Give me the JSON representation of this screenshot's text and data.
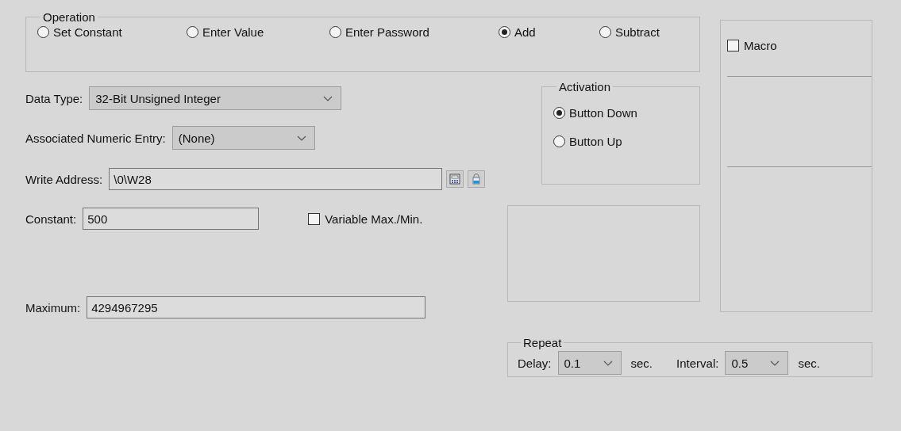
{
  "operation": {
    "title": "Operation",
    "options": [
      {
        "label": "Set Constant",
        "selected": false
      },
      {
        "label": "Enter Value",
        "selected": false
      },
      {
        "label": "Enter Password",
        "selected": false
      },
      {
        "label": "Add",
        "selected": true
      },
      {
        "label": "Subtract",
        "selected": false
      }
    ]
  },
  "macro": {
    "label": "Macro",
    "checked": false
  },
  "data_type": {
    "label": "Data Type:",
    "value": "32-Bit Unsigned Integer"
  },
  "associated_numeric_entry": {
    "label": "Associated Numeric Entry:",
    "value": "(None)"
  },
  "write_address": {
    "label": "Write Address:",
    "value": "\\0\\W28"
  },
  "constant": {
    "label": "Constant:",
    "value": "500"
  },
  "variable_max_min": {
    "label": "Variable Max./Min.",
    "checked": false
  },
  "maximum": {
    "label": "Maximum:",
    "value": "4294967295"
  },
  "activation": {
    "title": "Activation",
    "options": [
      {
        "label": "Button Down",
        "selected": true
      },
      {
        "label": "Button Up",
        "selected": false
      }
    ]
  },
  "repeat": {
    "title": "Repeat",
    "delay": {
      "label": "Delay:",
      "value": "0.1",
      "unit": "sec."
    },
    "interval": {
      "label": "Interval:",
      "value": "0.5",
      "unit": "sec."
    }
  }
}
